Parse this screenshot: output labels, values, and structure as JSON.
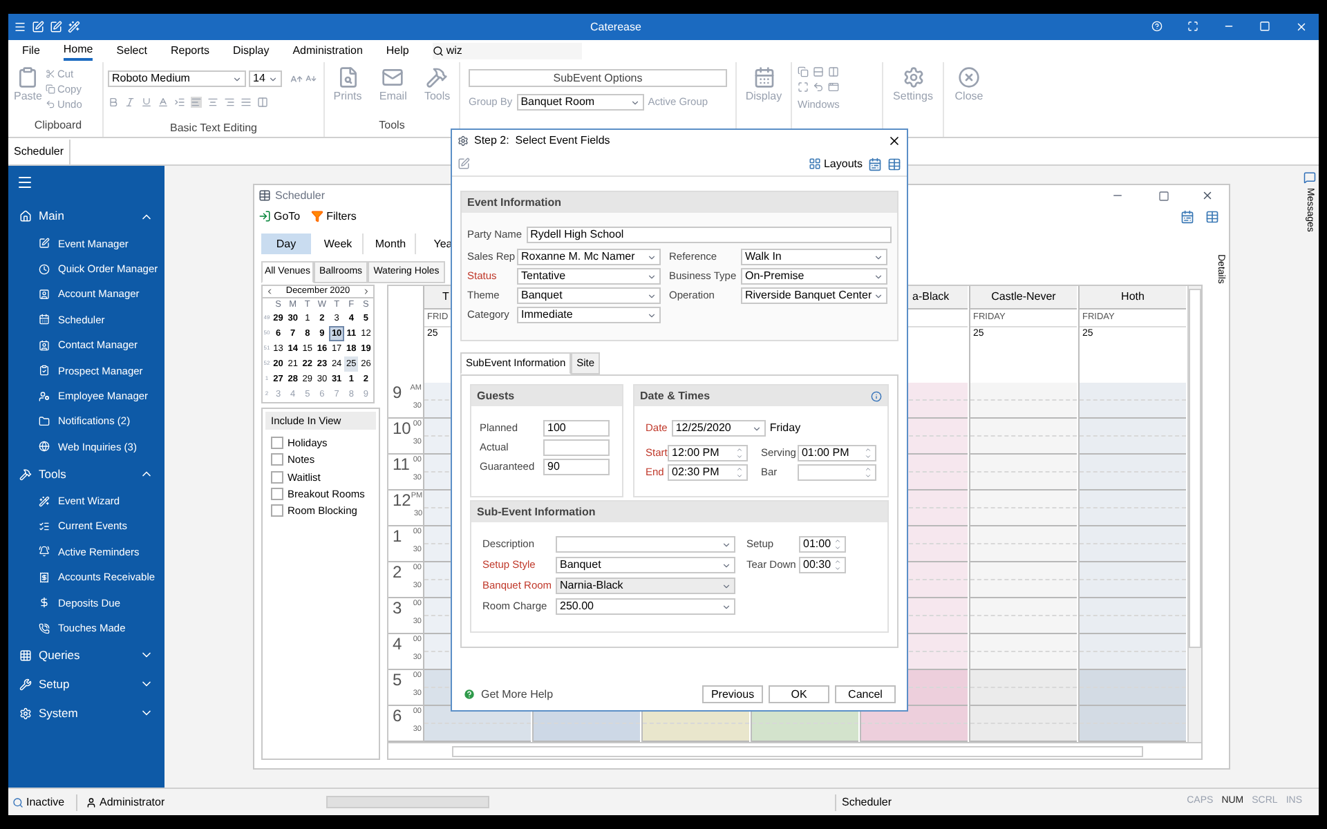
{
  "window": {
    "title": "Caterease"
  },
  "menu": [
    {
      "label": "File",
      "selected": false
    },
    {
      "label": "Home",
      "selected": true
    },
    {
      "label": "Select",
      "selected": false
    },
    {
      "label": "Reports",
      "selected": false
    },
    {
      "label": "Display",
      "selected": false
    },
    {
      "label": "Administration",
      "selected": false
    },
    {
      "label": "Help",
      "selected": false
    }
  ],
  "search": {
    "value": "wiz"
  },
  "ribbon": {
    "clipboard": {
      "paste": "Paste",
      "small": [
        "Cut",
        "Copy",
        "Undo"
      ],
      "label": "Clipboard"
    },
    "text_editing": {
      "font": "Roboto Medium",
      "size": "14",
      "label": "Basic Text Editing"
    },
    "tools": {
      "buttons": [
        "Prints",
        "Email",
        "Tools"
      ],
      "label": "Tools"
    },
    "scheduler": {
      "subevent_options": "SubEvent Options",
      "group_by_label": "Group By",
      "group_by": "Banquet Room",
      "active_group": "Active Group"
    },
    "display": "Display",
    "windows": "Windows",
    "settings": "Settings",
    "close": "Close"
  },
  "doc_tabs": [
    {
      "label": "Scheduler",
      "selected": true
    }
  ],
  "sidebar": {
    "sections": [
      {
        "label": "Main",
        "expanded": true,
        "items": [
          "Event Manager",
          "Quick Order Manager",
          "Account Manager",
          "Scheduler",
          "Contact Manager",
          "Prospect Manager",
          "Employee Manager",
          "Notifications (2)",
          "Web Inquiries (3)"
        ]
      },
      {
        "label": "Tools",
        "expanded": true,
        "items": [
          "Event Wizard",
          "Current Events",
          "Active Reminders",
          "Accounts Receivable",
          "Deposits Due",
          "Touches Made"
        ]
      },
      {
        "label": "Queries",
        "expanded": false
      },
      {
        "label": "Setup",
        "expanded": false
      },
      {
        "label": "System",
        "expanded": false
      }
    ]
  },
  "scheduler": {
    "title": "Scheduler",
    "goto": "GoTo",
    "filters": "Filters",
    "views": [
      {
        "label": "Day",
        "selected": true
      },
      {
        "label": "Week",
        "selected": false
      },
      {
        "label": "Month",
        "selected": false
      },
      {
        "label": "Yea",
        "selected": false
      }
    ],
    "venues": [
      {
        "label": "All Venues",
        "selected": true
      },
      {
        "label": "Ballrooms",
        "selected": false
      },
      {
        "label": "Watering Holes",
        "selected": false
      }
    ],
    "mini_calendar": {
      "month": "December 2020",
      "weekdays": [
        "S",
        "M",
        "T",
        "W",
        "T",
        "F",
        "S"
      ],
      "weeks": [
        {
          "week": "49",
          "days": [
            {
              "d": "29",
              "bold": true,
              "today": false,
              "selected": false
            },
            {
              "d": "30",
              "bold": true,
              "today": false,
              "selected": false
            },
            {
              "d": "1",
              "bold": false,
              "today": false,
              "selected": false
            },
            {
              "d": "2",
              "bold": true,
              "today": false,
              "selected": false
            },
            {
              "d": "3",
              "bold": false,
              "today": false,
              "selected": false
            },
            {
              "d": "4",
              "bold": true,
              "today": false,
              "selected": false
            },
            {
              "d": "5",
              "bold": true,
              "today": false,
              "selected": false
            }
          ]
        },
        {
          "week": "50",
          "days": [
            {
              "d": "6",
              "bold": true,
              "today": false,
              "selected": false
            },
            {
              "d": "7",
              "bold": true,
              "today": false,
              "selected": false
            },
            {
              "d": "8",
              "bold": true,
              "today": false,
              "selected": false
            },
            {
              "d": "9",
              "bold": true,
              "today": false,
              "selected": false
            },
            {
              "d": "10",
              "bold": true,
              "today": true,
              "selected": false
            },
            {
              "d": "11",
              "bold": true,
              "today": false,
              "selected": false
            },
            {
              "d": "12",
              "bold": false,
              "today": false,
              "selected": false
            }
          ]
        },
        {
          "week": "51",
          "days": [
            {
              "d": "13",
              "bold": false,
              "today": false,
              "selected": false
            },
            {
              "d": "14",
              "bold": true,
              "today": false,
              "selected": false
            },
            {
              "d": "15",
              "bold": false,
              "today": false,
              "selected": false
            },
            {
              "d": "16",
              "bold": true,
              "today": false,
              "selected": false
            },
            {
              "d": "17",
              "bold": false,
              "today": false,
              "selected": false
            },
            {
              "d": "18",
              "bold": true,
              "today": false,
              "selected": false
            },
            {
              "d": "19",
              "bold": true,
              "today": false,
              "selected": false
            }
          ]
        },
        {
          "week": "52",
          "days": [
            {
              "d": "20",
              "bold": true,
              "today": false,
              "selected": false
            },
            {
              "d": "21",
              "bold": false,
              "today": false,
              "selected": false
            },
            {
              "d": "22",
              "bold": true,
              "today": false,
              "selected": false
            },
            {
              "d": "23",
              "bold": true,
              "today": false,
              "selected": false
            },
            {
              "d": "24",
              "bold": false,
              "today": false,
              "selected": false
            },
            {
              "d": "25",
              "bold": false,
              "today": false,
              "selected": true
            },
            {
              "d": "26",
              "bold": false,
              "today": false,
              "selected": false
            }
          ]
        },
        {
          "week": "1",
          "days": [
            {
              "d": "27",
              "bold": true,
              "today": false,
              "selected": false
            },
            {
              "d": "28",
              "bold": true,
              "today": false,
              "selected": false
            },
            {
              "d": "29",
              "bold": false,
              "today": false,
              "selected": false
            },
            {
              "d": "30",
              "bold": false,
              "today": false,
              "selected": false
            },
            {
              "d": "31",
              "bold": true,
              "today": false,
              "selected": false
            },
            {
              "d": "1",
              "bold": true,
              "today": false,
              "selected": false
            },
            {
              "d": "2",
              "bold": true,
              "today": false,
              "selected": false
            }
          ]
        },
        {
          "week": "2",
          "days": [
            {
              "d": "3",
              "bold": false,
              "today": false,
              "selected": false
            },
            {
              "d": "4",
              "bold": false,
              "today": false,
              "selected": false
            },
            {
              "d": "5",
              "bold": false,
              "today": false,
              "selected": false
            },
            {
              "d": "6",
              "bold": false,
              "today": false,
              "selected": false
            },
            {
              "d": "7",
              "bold": false,
              "today": false,
              "selected": false
            },
            {
              "d": "8",
              "bold": false,
              "today": false,
              "selected": false
            },
            {
              "d": "9",
              "bold": false,
              "today": false,
              "selected": false
            }
          ]
        }
      ]
    },
    "include_in_view": {
      "title": "Include In View",
      "items": [
        {
          "label": "Holidays",
          "checked": false
        },
        {
          "label": "Notes",
          "checked": false
        },
        {
          "label": "Waitlist",
          "checked": false
        },
        {
          "label": "Breakout Rooms",
          "checked": false
        },
        {
          "label": "Room Blocking",
          "checked": false
        }
      ]
    },
    "columns": [
      {
        "name": "T",
        "day": "FRID",
        "date": "25",
        "kind": "lead",
        "color": "#d9e1ea"
      },
      {
        "color": "#cdd8e6"
      },
      {
        "color": "#e9e6cc"
      },
      {
        "color": "#d3e3cc"
      },
      {
        "name": "a-Black",
        "kind": "clipped",
        "color": "#edcfdc"
      },
      {
        "name": "Castle-Never",
        "day": "FRIDAY",
        "date": "25",
        "kind": "full",
        "color": "#ebebeb"
      },
      {
        "name": "Hoth",
        "day": "FRIDAY",
        "date": "25",
        "kind": "full",
        "color": "#d3dbe4"
      }
    ],
    "times": [
      {
        "hour": "9",
        "mark": "AM",
        "half": "30",
        "shaded": false
      },
      {
        "hour": "10",
        "mark": "00",
        "half": "30",
        "shaded": false
      },
      {
        "hour": "11",
        "mark": "00",
        "half": "30",
        "shaded": false
      },
      {
        "hour": "12",
        "mark": "PM",
        "half": "30",
        "shaded": false
      },
      {
        "hour": "1",
        "mark": "00",
        "half": "30",
        "shaded": false
      },
      {
        "hour": "2",
        "mark": "00",
        "half": "30",
        "shaded": false
      },
      {
        "hour": "3",
        "mark": "00",
        "half": "30",
        "shaded": false
      },
      {
        "hour": "4",
        "mark": "00",
        "half": "30",
        "shaded": false
      },
      {
        "hour": "5",
        "mark": "00",
        "half": "30",
        "shaded": true
      },
      {
        "hour": "6",
        "mark": "00",
        "half": "30",
        "shaded": true
      }
    ],
    "details_label": "Details"
  },
  "messages_label": "Messages",
  "dialog": {
    "title": "Step 2:  Select Event Fields",
    "layouts": "Layouts",
    "event_info": {
      "title": "Event Information",
      "party_name": {
        "label": "Party Name",
        "value": "Rydell High School"
      },
      "left_fields": [
        {
          "label": "Sales Rep",
          "value": "Roxanne M. Mc Namer",
          "required": false
        },
        {
          "label": "Status",
          "value": "Tentative",
          "required": true
        },
        {
          "label": "Theme",
          "value": "Banquet",
          "required": false
        },
        {
          "label": "Category",
          "value": "Immediate",
          "required": false
        }
      ],
      "right_fields": [
        {
          "label": "Reference",
          "value": "Walk In",
          "required": false
        },
        {
          "label": "Business Type",
          "value": "On-Premise",
          "required": false
        },
        {
          "label": "Operation",
          "value": "Riverside Banquet Center",
          "required": false
        }
      ]
    },
    "tabs": [
      {
        "label": "SubEvent Information",
        "selected": true
      },
      {
        "label": "Site",
        "selected": false
      }
    ],
    "guests": {
      "title": "Guests",
      "fields": [
        {
          "label": "Planned",
          "value": "100"
        },
        {
          "label": "Actual"
        },
        {
          "label": "Guaranteed",
          "value": "90"
        }
      ]
    },
    "date_times": {
      "title": "Date & Times",
      "date": {
        "label": "Date",
        "value": "12/25/2020"
      },
      "weekday": "Friday",
      "fields": [
        {
          "label": "Start",
          "value": "12:00 PM",
          "required": true
        },
        {
          "label": "Serving",
          "value": "01:00 PM",
          "required": false
        },
        {
          "label": "End",
          "value": "02:30 PM",
          "required": true
        },
        {
          "label": "Bar",
          "required": false
        }
      ]
    },
    "sub_event": {
      "title": "Sub-Event Information",
      "fields": [
        {
          "label": "Description",
          "required": false,
          "focused": false
        },
        {
          "label": "Setup Style",
          "value": "Banquet",
          "required": true,
          "focused": false
        },
        {
          "label": "Banquet Room",
          "value": "Narnia-Black",
          "required": true,
          "focused": true
        },
        {
          "label": "Room Charge",
          "value": "250.00",
          "required": false,
          "focused": false
        }
      ],
      "timing": [
        {
          "label": "Setup",
          "value": "01:00"
        },
        {
          "label": "Tear Down",
          "value": "00:30"
        }
      ]
    },
    "help": "Get More Help",
    "buttons": [
      "Previous",
      "OK",
      "Cancel"
    ]
  },
  "status_bar": {
    "state": "Inactive",
    "user": "Administrator",
    "progress": {
      "level": 0
    },
    "module": "Scheduler",
    "keys": [
      {
        "label": "CAPS",
        "on": false
      },
      {
        "label": "NUM",
        "on": true
      },
      {
        "label": "SCRL",
        "on": false
      },
      {
        "label": "INS",
        "on": false
      }
    ]
  }
}
